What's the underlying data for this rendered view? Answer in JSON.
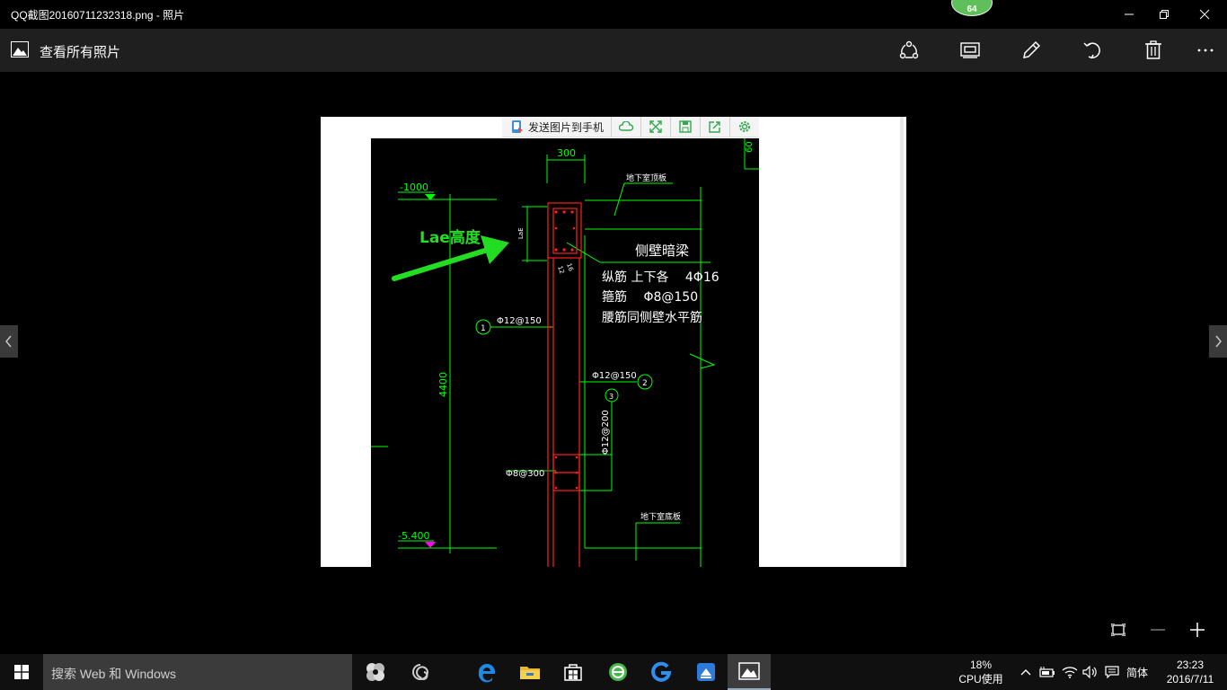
{
  "window": {
    "title": "QQ截图20160711232318.png - 照片",
    "notification_badge": "64"
  },
  "appbar": {
    "label": "查看所有照片"
  },
  "sendbar": {
    "label": "发送图片到手机"
  },
  "drawing": {
    "dim_300": "300",
    "dim_60": "60",
    "elev_top": "-1000",
    "elev_bottom": "-5.400",
    "roof_label": "地下室顶板",
    "floor_label": "地下室底板",
    "annotation": "Lae高度",
    "lae_small": "LaE",
    "beam_title": "侧壁暗梁",
    "beam_line1": "纵筋 上下各　 4Φ16",
    "beam_line2": "箍筋　 Φ8@150",
    "beam_line3": "腰筋同侧壁水平筋",
    "small_16": "16",
    "small_12": "12",
    "bar1_label": "Φ12@150",
    "bar1_num": "1",
    "bar2_label": "Φ12@150",
    "bar2_num": "2",
    "bar3_label": "Φ12@200",
    "bar3_num": "3",
    "tie_label": "Φ8@300",
    "height_dim": "4400"
  },
  "taskbar": {
    "search_placeholder": "搜索 Web 和 Windows",
    "cpu_percent": "18%",
    "cpu_label": "CPU使用",
    "ime": "简体",
    "time": "23:23",
    "date": "2016/7/11"
  },
  "colors": {
    "cad_green": "#00ff00",
    "cad_red": "#ff2020",
    "annotation_green": "#22dd22",
    "magenta": "#ff00ff"
  }
}
